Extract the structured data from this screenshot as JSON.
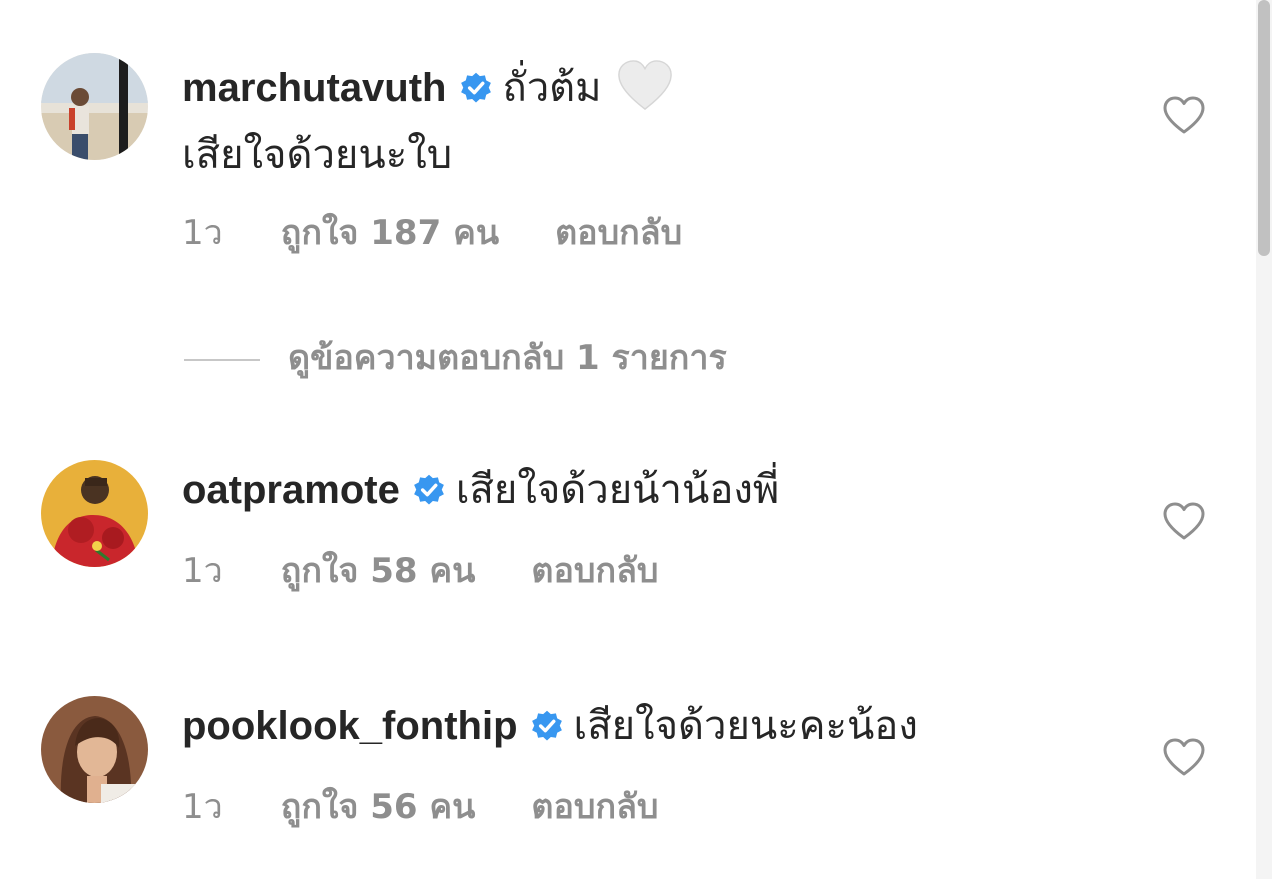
{
  "comments": [
    {
      "username": "marchutavuth",
      "verified": true,
      "text_line1": "ถั่วต้ม",
      "emoji": "white-heart",
      "text_line2": "เสียใจด้วยนะใบ",
      "time": "1ว",
      "likes": "ถูกใจ 187 คน",
      "reply": "ตอบกลับ",
      "view_replies": "ดูข้อความตอบกลับ 1 รายการ"
    },
    {
      "username": "oatpramote",
      "verified": true,
      "text_line1": "เสียใจด้วยน้าน้องพี่",
      "time": "1ว",
      "likes": "ถูกใจ 58 คน",
      "reply": "ตอบกลับ"
    },
    {
      "username": "pooklook_fonthip",
      "verified": true,
      "text_line1": "เสียใจด้วยนะคะน้อง",
      "time": "1ว",
      "likes": "ถูกใจ 56 คน",
      "reply": "ตอบกลับ"
    }
  ],
  "icons": {
    "verified": "verified-badge-icon",
    "like": "heart-outline-icon"
  },
  "colors": {
    "verified_blue": "#3897f0",
    "meta_gray": "#8e8e8e",
    "text": "#262626"
  }
}
